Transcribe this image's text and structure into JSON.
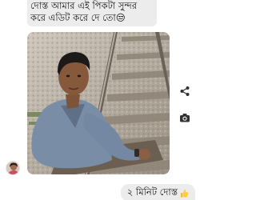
{
  "incoming_message": {
    "line1": "দোস্ত আমার এই পিকটা সুন্দর",
    "line2": "করে এডিট করে দে তো😒"
  },
  "outgoing_message": {
    "text": "২ মিনিট দোস্ত",
    "emoji_icon": "thumbs-up-icon"
  },
  "icons": {
    "share": "share-icon",
    "camera": "camera-icon",
    "avatar": "avatar"
  },
  "colors": {
    "bubble": "#ececec",
    "text": "#111111",
    "shirt": "#7a8da7"
  }
}
